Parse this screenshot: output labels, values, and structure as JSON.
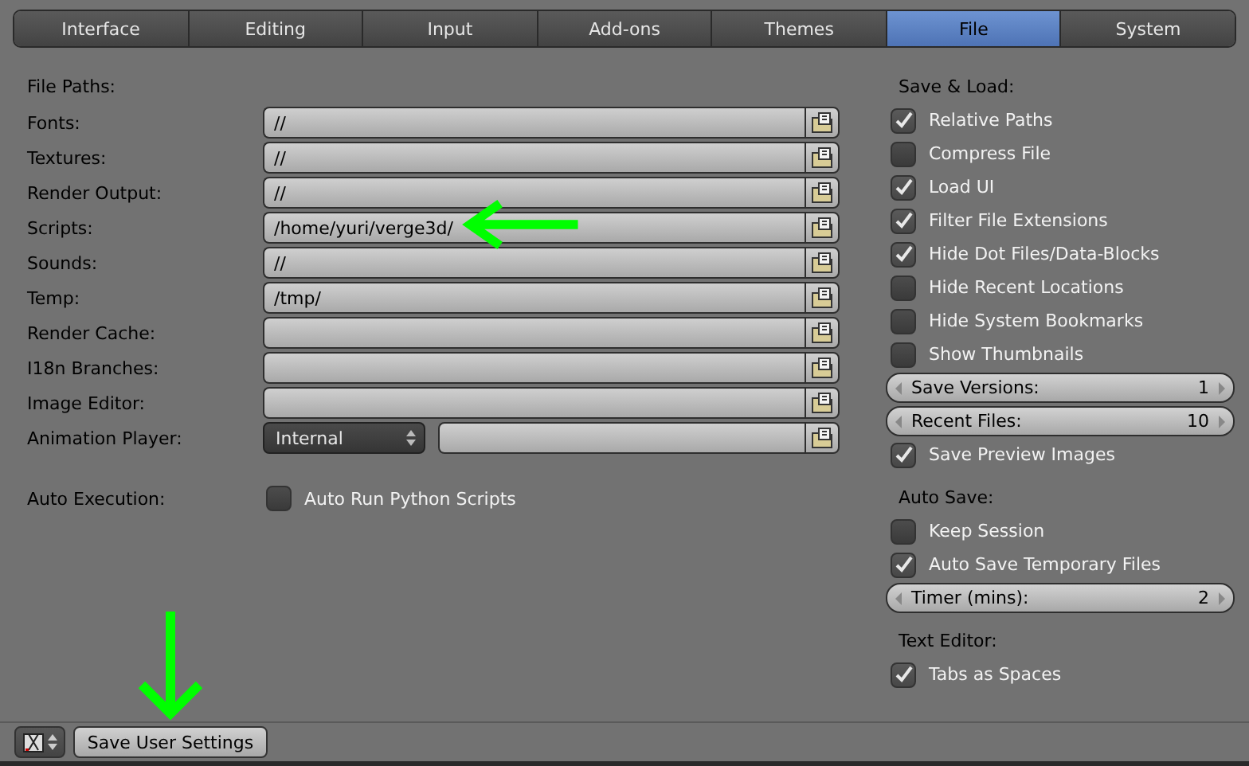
{
  "tabs": [
    {
      "label": "Interface",
      "selected": false
    },
    {
      "label": "Editing",
      "selected": false
    },
    {
      "label": "Input",
      "selected": false
    },
    {
      "label": "Add-ons",
      "selected": false
    },
    {
      "label": "Themes",
      "selected": false
    },
    {
      "label": "File",
      "selected": true
    },
    {
      "label": "System",
      "selected": false
    }
  ],
  "file_paths": {
    "heading": "File Paths:",
    "rows": [
      {
        "kind": "path",
        "label": "Fonts:",
        "value": "//"
      },
      {
        "kind": "path",
        "label": "Textures:",
        "value": "//"
      },
      {
        "kind": "path",
        "label": "Render Output:",
        "value": "//"
      },
      {
        "kind": "path",
        "label": "Scripts:",
        "value": "/home/yuri/verge3d/"
      },
      {
        "kind": "path",
        "label": "Sounds:",
        "value": "//"
      },
      {
        "kind": "path",
        "label": "Temp:",
        "value": "/tmp/"
      },
      {
        "kind": "path",
        "label": "Render Cache:"
      },
      {
        "kind": "path",
        "label": "I18n Branches:"
      },
      {
        "kind": "path",
        "label": "Image Editor:"
      },
      {
        "kind": "player",
        "label": "Animation Player:",
        "choice": "Internal"
      }
    ],
    "auto_execution": {
      "label": "Auto Execution:",
      "option": "Auto Run Python Scripts",
      "checked": false
    }
  },
  "right": [
    {
      "kind": "heading",
      "label": "Save & Load:"
    },
    {
      "kind": "check",
      "label": "Relative Paths",
      "checked": true
    },
    {
      "kind": "check",
      "label": "Compress File",
      "checked": false
    },
    {
      "kind": "check",
      "label": "Load UI",
      "checked": true
    },
    {
      "kind": "check",
      "label": "Filter File Extensions",
      "checked": true
    },
    {
      "kind": "check",
      "label": "Hide Dot Files/Data-Blocks",
      "checked": true
    },
    {
      "kind": "check",
      "label": "Hide Recent Locations",
      "checked": false
    },
    {
      "kind": "check",
      "label": "Hide System Bookmarks",
      "checked": false
    },
    {
      "kind": "check",
      "label": "Show Thumbnails",
      "checked": false
    },
    {
      "kind": "number",
      "label": "Save Versions:",
      "value": "1"
    },
    {
      "kind": "number",
      "label": "Recent Files:",
      "value": "10"
    },
    {
      "kind": "check",
      "label": "Save Preview Images",
      "checked": true
    },
    {
      "kind": "heading",
      "label": "Auto Save:"
    },
    {
      "kind": "check",
      "label": "Keep Session",
      "checked": false
    },
    {
      "kind": "check",
      "label": "Auto Save Temporary Files",
      "checked": true
    },
    {
      "kind": "number",
      "label": "Timer (mins):",
      "value": "2"
    },
    {
      "kind": "heading",
      "label": "Text Editor:"
    },
    {
      "kind": "check",
      "label": "Tabs as Spaces",
      "checked": true
    }
  ],
  "footer": {
    "button": "Save User Settings"
  }
}
